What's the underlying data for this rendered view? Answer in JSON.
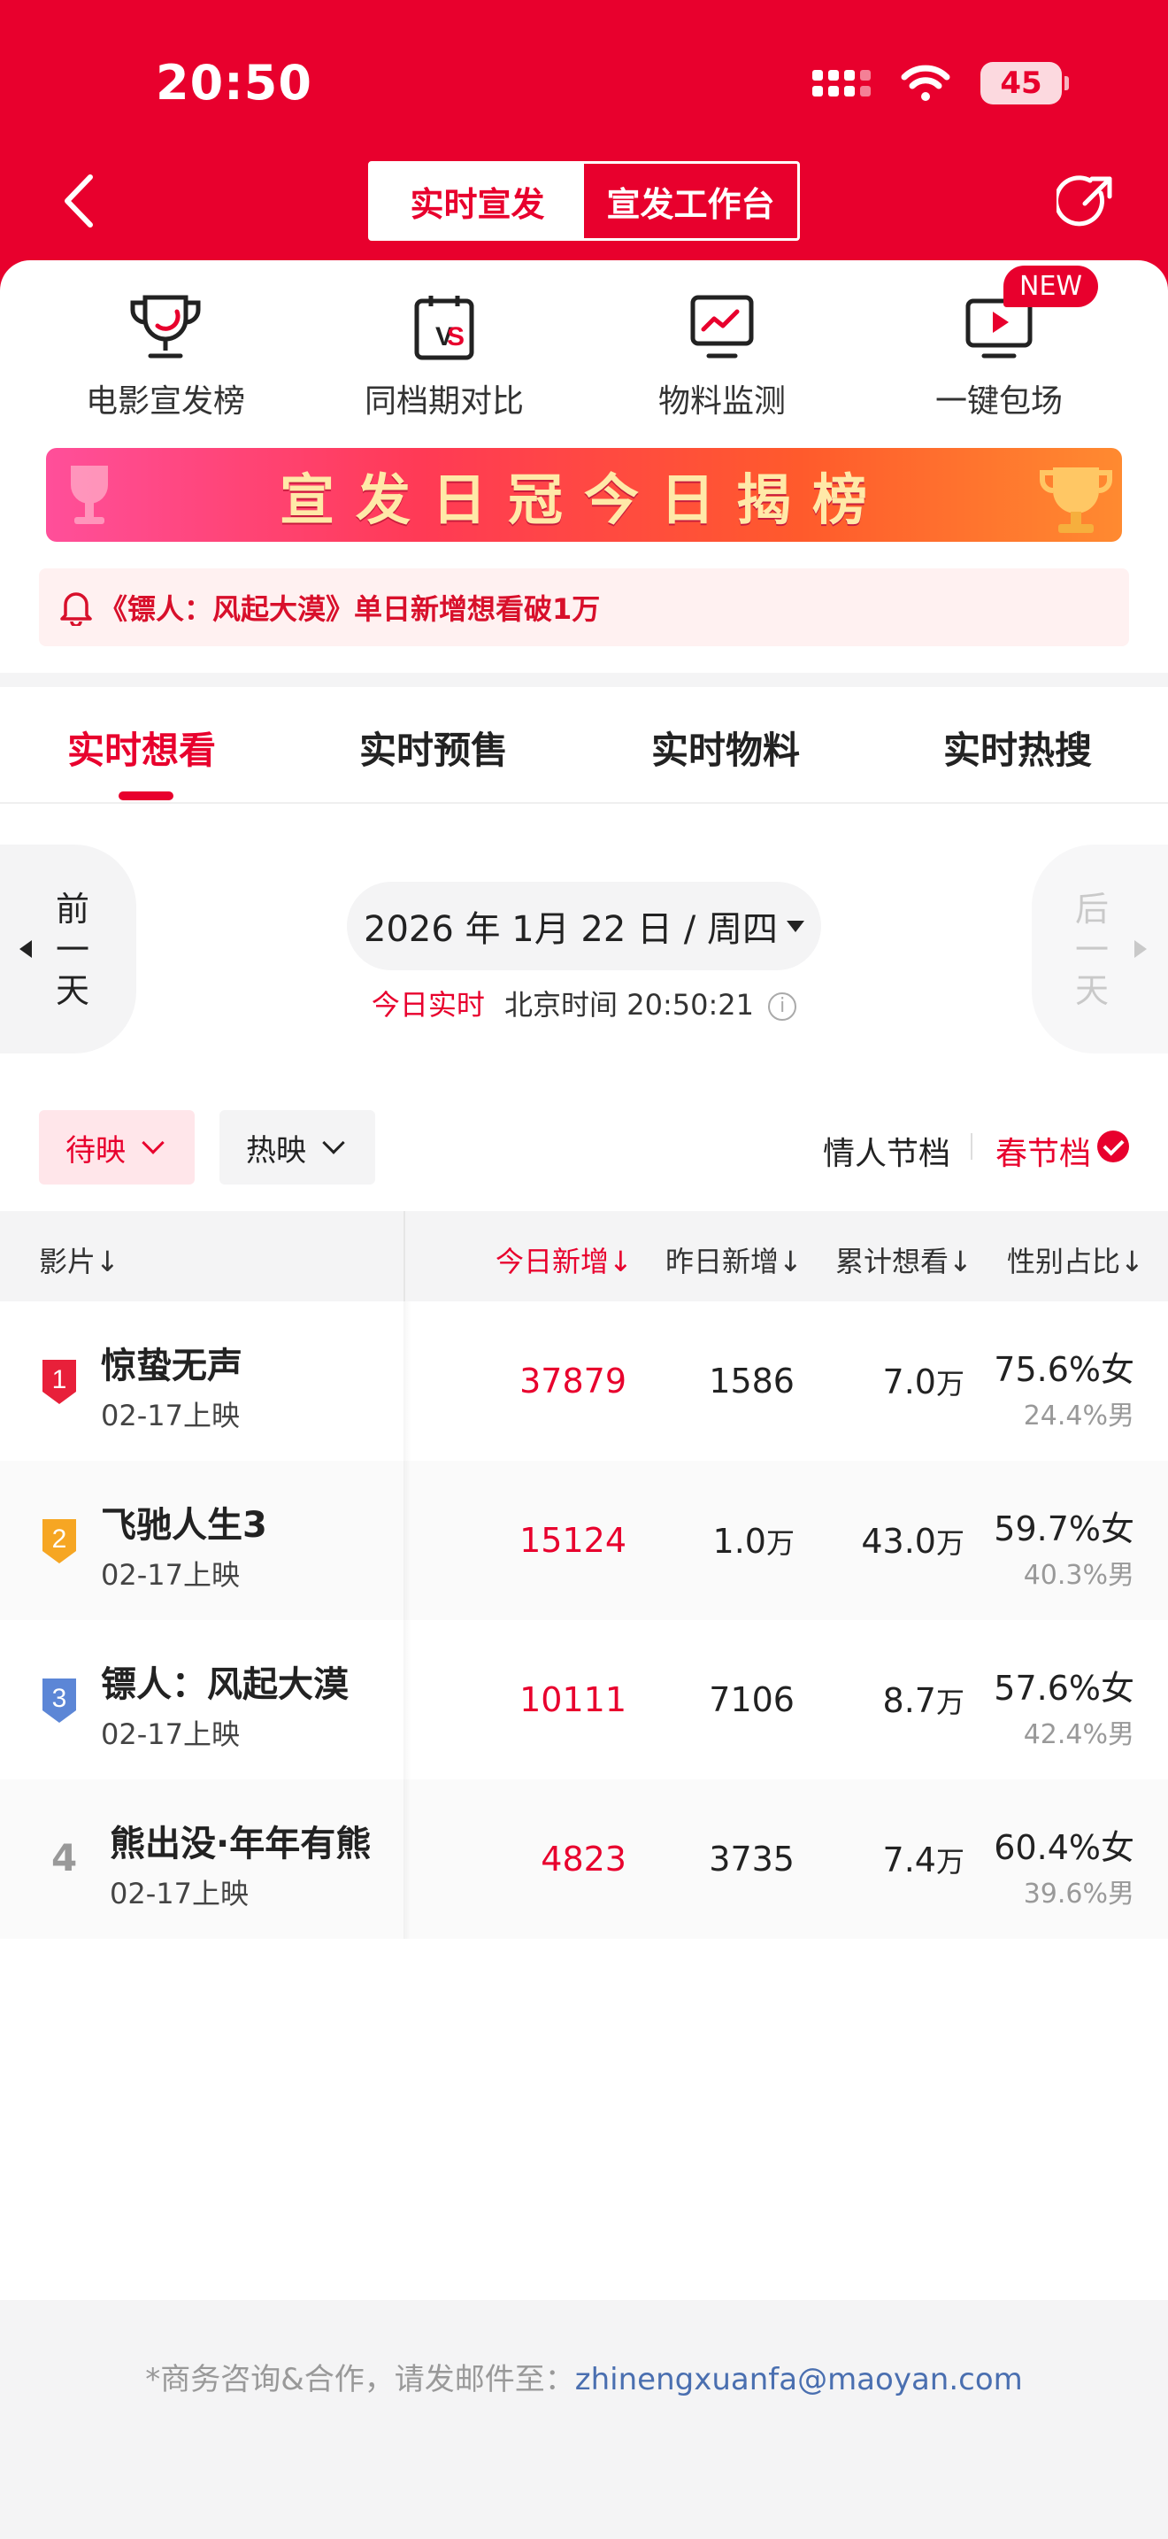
{
  "status_bar": {
    "time": "20:50",
    "battery": "45"
  },
  "header": {
    "segment": {
      "active": "实时宣发",
      "inactive": "宣发工作台"
    }
  },
  "shortcuts": [
    {
      "label": "电影宣发榜",
      "icon": "trophy-icon"
    },
    {
      "label": "同档期对比",
      "icon": "vs-calendar-icon"
    },
    {
      "label": "物料监测",
      "icon": "monitor-chart-icon"
    },
    {
      "label": "一键包场",
      "icon": "tv-play-icon",
      "badge": "NEW"
    }
  ],
  "banner": {
    "text": "宣发日冠今日揭榜"
  },
  "notice": {
    "text": "《镖人：风起大漠》单日新增想看破1万"
  },
  "tabs": [
    {
      "label": "实时想看",
      "active": true
    },
    {
      "label": "实时预售",
      "active": false
    },
    {
      "label": "实时物料",
      "active": false
    },
    {
      "label": "实时热搜",
      "active": false
    }
  ],
  "date_nav": {
    "prev": "前一天",
    "next": "后一天",
    "date": "2026 年 1月 22 日 / 周四",
    "realtime_label": "今日实时",
    "beijing_time": "北京时间 20:50:21"
  },
  "filters": {
    "status": "待映",
    "sort": "热映",
    "season_1": "情人节档",
    "season_2": "春节档"
  },
  "table": {
    "headers": {
      "film": "影片↓",
      "today": "今日新增↓",
      "yesterday": "昨日新增↓",
      "total": "累计想看↓",
      "gender": "性别占比↓"
    },
    "rows": [
      {
        "rank": "1",
        "title": "惊蛰无声",
        "release": "02-17上映",
        "today": "37879",
        "yesterday": "1586",
        "yesterday_unit": "",
        "total": "7.0",
        "total_unit": "万",
        "female": "75.6%女",
        "male": "24.4%男"
      },
      {
        "rank": "2",
        "title": "飞驰人生3",
        "release": "02-17上映",
        "today": "15124",
        "yesterday": "1.0",
        "yesterday_unit": "万",
        "total": "43.0",
        "total_unit": "万",
        "female": "59.7%女",
        "male": "40.3%男"
      },
      {
        "rank": "3",
        "title": "镖人：风起大漠",
        "release": "02-17上映",
        "today": "10111",
        "yesterday": "7106",
        "yesterday_unit": "",
        "total": "8.7",
        "total_unit": "万",
        "female": "57.6%女",
        "male": "42.4%男"
      },
      {
        "rank": "4",
        "title": "熊出没·年年有熊",
        "release": "02-17上映",
        "today": "4823",
        "yesterday": "3735",
        "yesterday_unit": "",
        "total": "7.4",
        "total_unit": "万",
        "female": "60.4%女",
        "male": "39.6%男"
      }
    ]
  },
  "footer": {
    "text": "*商务咨询&合作，请发邮件至：",
    "email": "zhinengxuanfa@maoyan.com"
  },
  "colors": {
    "brand_red": "#e8002d",
    "rank1": "#e8203a",
    "rank2": "#f6a623",
    "rank3": "#5c86d6"
  }
}
